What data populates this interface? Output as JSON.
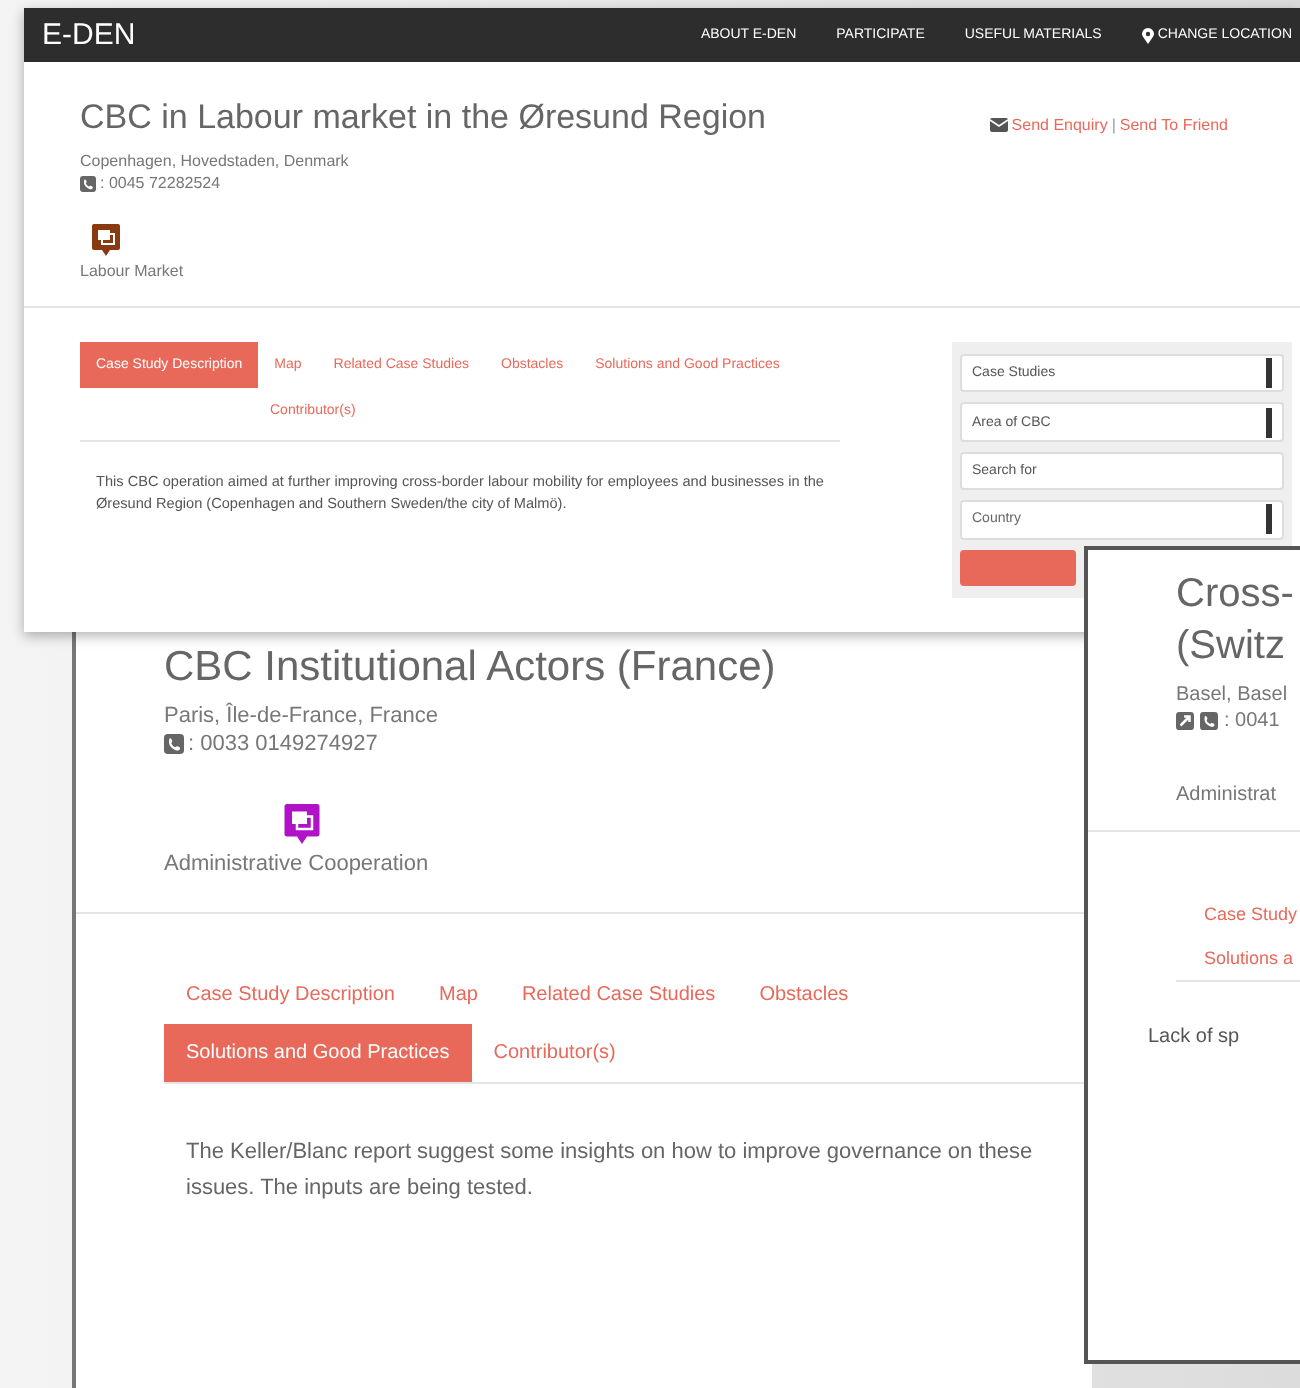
{
  "front_page": {
    "navbar": {
      "brand": "E-DEN",
      "links": [
        {
          "label": "ABOUT E-DEN",
          "kind": "plain"
        },
        {
          "label": "PARTICIPATE",
          "kind": "plain"
        },
        {
          "label": "USEFUL MATERIALS",
          "kind": "plain"
        },
        {
          "label": "CHANGE LOCATION",
          "kind": "location"
        }
      ]
    },
    "title_lines": [
      "CBC in Labour market in the Øresund Region"
    ],
    "location": "Copenhagen, Hovedstaden, Denmark",
    "contacts": [
      {
        "kind": "phone"
      }
    ],
    "phone": ": 0045 72282524",
    "category": {
      "label": "Labour Market",
      "color": "#8a3a10"
    },
    "actions": [
      "Send Enquiry",
      "Send To Friend"
    ],
    "action_separator": "|",
    "tabs": [
      {
        "label": "Case Study Description",
        "selected": true
      },
      {
        "label": "Map",
        "selected": false
      },
      {
        "label": "Related Case Studies",
        "selected": false
      },
      {
        "label": "Obstacles",
        "selected": false
      },
      {
        "label": "Solutions and Good Practices",
        "selected": false
      },
      {
        "label": "Contributor(s)",
        "selected": false
      }
    ],
    "description": "This CBC operation aimed at further improving cross-border labour mobility for employees and businesses in the Øresund Region (Copenhagen and Southern Sweden/the city of Malmö).",
    "search_panel": {
      "fields": [
        {
          "kind": "select",
          "value": "Case Studies"
        },
        {
          "kind": "select",
          "value": "Area of CBC"
        },
        {
          "kind": "input",
          "placeholder": "Search for"
        },
        {
          "kind": "select",
          "placeholder": "Country"
        }
      ]
    }
  },
  "back_page": {
    "title_lines": [
      "CBC Institutional Actors (France)"
    ],
    "location": "Paris, Île-de-France, France",
    "contacts": [
      {
        "kind": "phone"
      }
    ],
    "phone": ": 0033 0149274927",
    "category": {
      "label": "Administrative Cooperation",
      "color": "#b012c8"
    },
    "tabs": [
      {
        "label": "Case Study Description",
        "selected": false
      },
      {
        "label": "Map",
        "selected": false
      },
      {
        "label": "Related Case Studies",
        "selected": false
      },
      {
        "label": "Obstacles",
        "selected": false
      },
      {
        "label": "Solutions and Good Practices",
        "selected": true
      },
      {
        "label": "Contributor(s)",
        "selected": false
      }
    ],
    "description": "The Keller/Blanc report suggest some insights on how to improve governance on these issues. The inputs are being tested."
  },
  "side_page": {
    "title_lines": [
      "Cross-",
      "(Switz"
    ],
    "location": "Basel, Basel",
    "contacts": [
      {
        "kind": "link"
      },
      {
        "kind": "phone"
      }
    ],
    "phone": ": 0041",
    "category": {
      "label": "Administrat"
    },
    "tabs": [
      {
        "label": "Case Study",
        "selected": false
      },
      {
        "label": "Solutions a",
        "selected": false
      }
    ],
    "description": "Lack of sp"
  }
}
